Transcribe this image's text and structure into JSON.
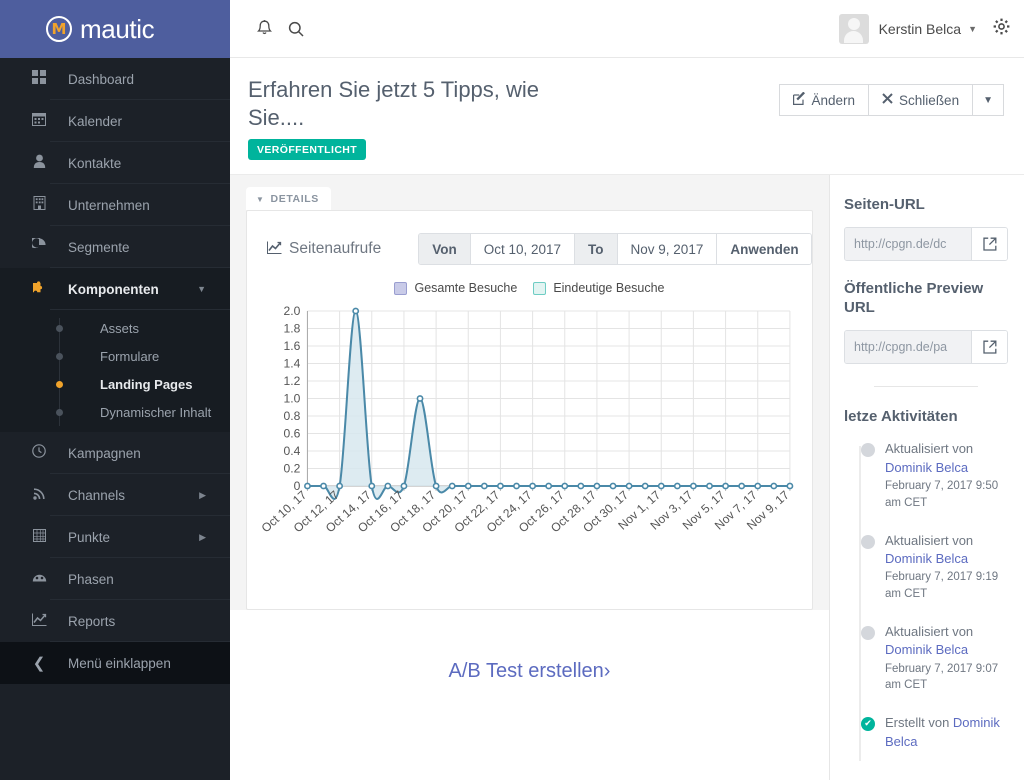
{
  "brand": {
    "name": "mautic",
    "logo_icon": "mautic-m-logo"
  },
  "sidebar": {
    "items": [
      {
        "label": "Dashboard",
        "icon": "dashboard-grid-icon",
        "icon_glyph": "▦",
        "active": false,
        "caret": ""
      },
      {
        "label": "Kalender",
        "icon": "calendar-icon",
        "icon_glyph": "▦",
        "active": false,
        "caret": ""
      },
      {
        "label": "Kontakte",
        "icon": "person-icon",
        "icon_glyph": "♟",
        "active": false,
        "caret": ""
      },
      {
        "label": "Unternehmen",
        "icon": "building-icon",
        "icon_glyph": "▤",
        "active": false,
        "caret": ""
      },
      {
        "label": "Segmente",
        "icon": "pie-chart-icon",
        "icon_glyph": "◕",
        "active": false,
        "caret": ""
      },
      {
        "label": "Komponenten",
        "icon": "puzzle-piece-icon",
        "icon_glyph": "✛",
        "active": true,
        "caret": "▼"
      }
    ],
    "sub_items": [
      {
        "label": "Assets",
        "active": false
      },
      {
        "label": "Formulare",
        "active": false
      },
      {
        "label": "Landing Pages",
        "active": true
      },
      {
        "label": "Dynamischer Inhalt",
        "active": false
      }
    ],
    "items_after": [
      {
        "label": "Kampagnen",
        "icon": "clock-icon",
        "icon_glyph": "◷",
        "active": false,
        "caret": ""
      },
      {
        "label": "Channels",
        "icon": "rss-icon",
        "icon_glyph": "≫",
        "active": false,
        "caret": "▶"
      },
      {
        "label": "Punkte",
        "icon": "grid-table-icon",
        "icon_glyph": "▦",
        "active": false,
        "caret": "▶"
      },
      {
        "label": "Phasen",
        "icon": "gauge-icon",
        "icon_glyph": "◍",
        "active": false,
        "caret": ""
      },
      {
        "label": "Reports",
        "icon": "line-chart-icon",
        "icon_glyph": "📈",
        "active": false,
        "caret": ""
      }
    ],
    "collapse": {
      "label": "Menü einklappen",
      "icon": "chevron-left-icon",
      "icon_glyph": "❮"
    }
  },
  "topbar": {
    "notifications_icon": "bell-icon",
    "notifications_glyph": "🔔",
    "search_icon": "search-icon",
    "search_glyph": "⚲",
    "user_name": "Kerstin Belca",
    "user_caret": "▼",
    "settings_icon": "gear-icon",
    "settings_glyph": "✿"
  },
  "page_header": {
    "title": "Erfahren Sie jetzt 5 Tipps, wie Sie....",
    "status_badge": "VERÖFFENTLICHT",
    "status_color": "#00b49c",
    "buttons": [
      {
        "label": "Ändern",
        "icon": "edit-pencil-icon",
        "glyph": "✎"
      },
      {
        "label": "Schließen",
        "icon": "close-x-icon",
        "glyph": "✖"
      }
    ],
    "dropdown_caret": "▼"
  },
  "tabs": [
    {
      "label": "DETAILS",
      "caret": "▼",
      "active": true
    }
  ],
  "chart_panel": {
    "title": "Seitenaufrufe",
    "title_icon": "line-chart-icon",
    "title_glyph": "📈",
    "date_from_label": "Von",
    "date_from_value": "Oct 10, 2017",
    "date_to_label": "To",
    "date_to_value": "Nov 9, 2017",
    "apply_label": "Anwenden"
  },
  "chart_data": {
    "type": "line",
    "title": "Seitenaufrufe",
    "xlabel": "",
    "ylabel": "",
    "ylim": [
      0,
      2.0
    ],
    "yticks": [
      "0",
      "0.2",
      "0.4",
      "0.6",
      "0.8",
      "1.0",
      "1.2",
      "1.4",
      "1.6",
      "1.8",
      "2.0"
    ],
    "grid": true,
    "legend_position": "top-center",
    "x": [
      "Oct 10, 17",
      "Oct 11, 17",
      "Oct 12, 17",
      "Oct 13, 17",
      "Oct 14, 17",
      "Oct 15, 17",
      "Oct 16, 17",
      "Oct 17, 17",
      "Oct 18, 17",
      "Oct 19, 17",
      "Oct 20, 17",
      "Oct 21, 17",
      "Oct 22, 17",
      "Oct 23, 17",
      "Oct 24, 17",
      "Oct 25, 17",
      "Oct 26, 17",
      "Oct 27, 17",
      "Oct 28, 17",
      "Oct 29, 17",
      "Oct 30, 17",
      "Oct 31, 17",
      "Nov 1, 17",
      "Nov 2, 17",
      "Nov 3, 17",
      "Nov 4, 17",
      "Nov 5, 17",
      "Nov 6, 17",
      "Nov 7, 17",
      "Nov 8, 17",
      "Nov 9, 17"
    ],
    "xtick_labels": [
      "Oct 10, 17",
      "Oct 12, 17",
      "Oct 14, 17",
      "Oct 16, 17",
      "Oct 18, 17",
      "Oct 20, 17",
      "Oct 22, 17",
      "Oct 24, 17",
      "Oct 26, 17",
      "Oct 28, 17",
      "Oct 30, 17",
      "Nov 1, 17",
      "Nov 3, 17",
      "Nov 5, 17",
      "Nov 7, 17",
      "Nov 9, 17"
    ],
    "series": [
      {
        "name": "Gesamte Besuche",
        "color": "#c9cbe8",
        "values": [
          0,
          0,
          0,
          0,
          0,
          0,
          0,
          0,
          0,
          0,
          0,
          0,
          0,
          0,
          0,
          0,
          0,
          0,
          0,
          0,
          0,
          0,
          0,
          0,
          0,
          0,
          0,
          0,
          0,
          0,
          0
        ]
      },
      {
        "name": "Eindeutige Besuche",
        "color": "#a8e3de",
        "line_color": "#4a89a8",
        "fill_color": "#d7e8ee",
        "values": [
          0,
          0,
          0,
          2,
          0,
          0,
          0,
          1,
          0,
          0,
          0,
          0,
          0,
          0,
          0,
          0,
          0,
          0,
          0,
          0,
          0,
          0,
          0,
          0,
          0,
          0,
          0,
          0,
          0,
          0,
          0
        ]
      }
    ]
  },
  "ab_test": {
    "label": "A/B Test erstellen",
    "caret": "›"
  },
  "right_panel": {
    "page_url_title": "Seiten-URL",
    "page_url_value": "http://cpgn.de/dc",
    "preview_url_title": "Öffentliche Preview URL",
    "preview_url_value": "http://cpgn.de/pa",
    "open_icon": "external-link-icon",
    "open_glyph": "↗",
    "activity_title": "letze Aktivitäten",
    "activities": [
      {
        "action": "Aktualisiert von",
        "who": "Dominik Belca",
        "time": "February 7, 2017 9:50 am CET",
        "done": false
      },
      {
        "action": "Aktualisiert von",
        "who": "Dominik Belca",
        "time": "February 7, 2017 9:19 am CET",
        "done": false
      },
      {
        "action": "Aktualisiert von",
        "who": "Dominik Belca",
        "time": "February 7, 2017 9:07 am CET",
        "done": false
      },
      {
        "action": "Erstellt von",
        "who": "Dominik Belca",
        "time": "",
        "done": true,
        "check_glyph": "✔"
      }
    ]
  }
}
